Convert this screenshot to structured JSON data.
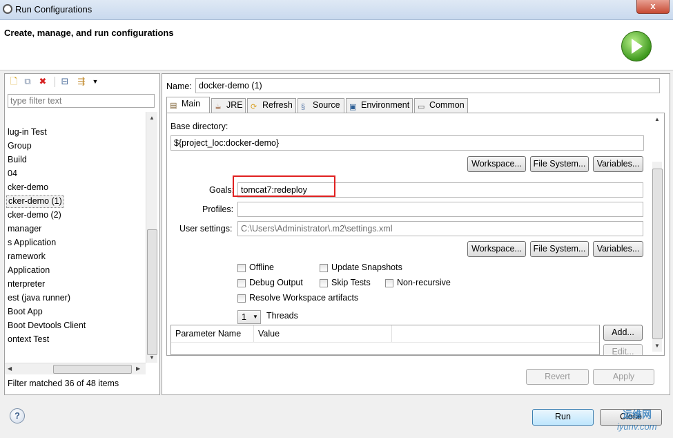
{
  "window": {
    "title": "Run Configurations",
    "close_glyph": "x"
  },
  "header": {
    "title": "Create, manage, and run configurations"
  },
  "left": {
    "filter_placeholder": "type filter text",
    "items": [
      "lug-in Test",
      "Group",
      "Build",
      "04",
      "cker-demo",
      "cker-demo (1)",
      "cker-demo (2)",
      "manager",
      "s Application",
      "ramework",
      "Application",
      "nterpreter",
      "est (java runner)",
      "Boot App",
      "Boot Devtools Client",
      "ontext Test"
    ],
    "selected_index": 5,
    "status": "Filter matched 36 of 48 items"
  },
  "right": {
    "name_label": "Name:",
    "name_value": "docker-demo (1)",
    "tabs": [
      "Main",
      "JRE",
      "Refresh",
      "Source",
      "Environment",
      "Common"
    ],
    "active_tab": "Main",
    "base_dir_label": "Base directory:",
    "base_dir_value": "${project_loc:docker-demo}",
    "btn_workspace": "Workspace...",
    "btn_filesystem": "File System...",
    "btn_variables": "Variables...",
    "goals_label": "Goals:",
    "goals_value": "tomcat7:redeploy",
    "profiles_label": "Profiles:",
    "profiles_value": "",
    "user_settings_label": "User settings:",
    "user_settings_value": "C:\\Users\\Administrator\\.m2\\settings.xml",
    "checks": {
      "offline": "Offline",
      "update_snapshots": "Update Snapshots",
      "debug_output": "Debug Output",
      "skip_tests": "Skip Tests",
      "non_recursive": "Non-recursive",
      "resolve_workspace": "Resolve Workspace artifacts"
    },
    "threads_value": "1",
    "threads_label": "Threads",
    "table_headers": [
      "Parameter Name",
      "Value"
    ],
    "btn_add": "Add...",
    "btn_edit": "Edit...",
    "btn_revert": "Revert",
    "btn_apply": "Apply"
  },
  "footer": {
    "run": "Run",
    "close": "Close",
    "help": "?"
  },
  "watermark": {
    "line1": "运维网",
    "line2": "iyunv.com"
  },
  "colors": {
    "highlight_box": "#e02020",
    "run_icon": "#3f9a1f"
  }
}
